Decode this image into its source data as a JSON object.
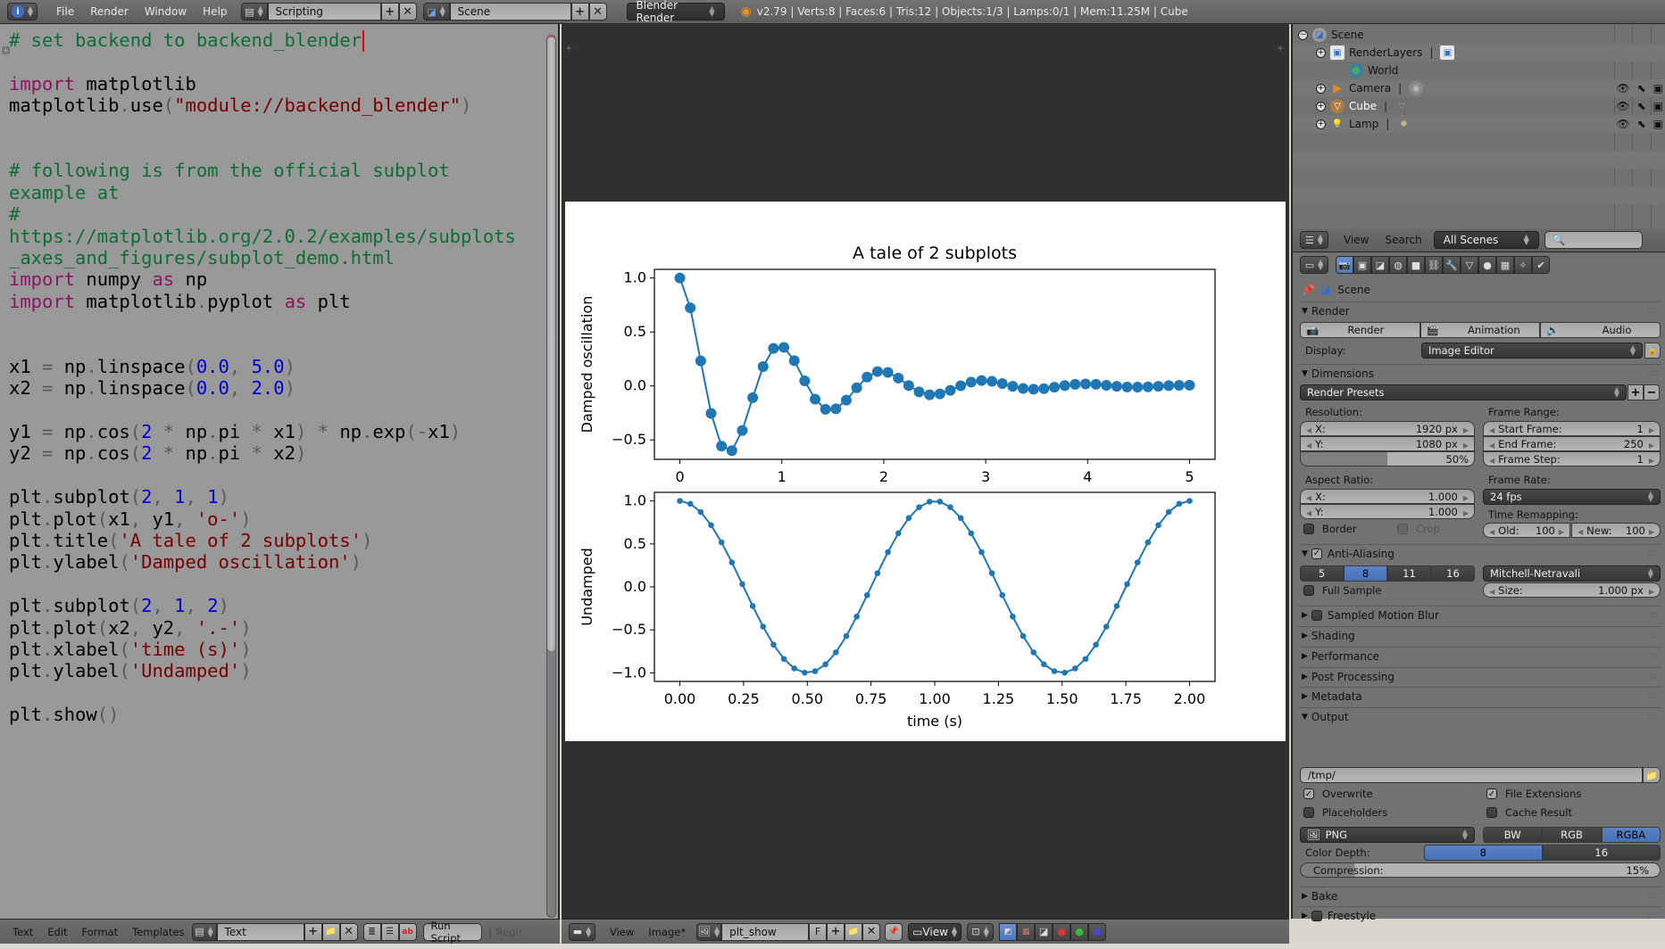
{
  "topbar": {
    "info_icon": "info-icon",
    "menus": [
      "File",
      "Render",
      "Window",
      "Help"
    ],
    "screen_layout": "Scripting",
    "scene": "Scene",
    "render_engine": "Blender Render",
    "stats": "v2.79 | Verts:8 | Faces:6 | Tris:12 | Objects:1/3 | Lamps:0/1 | Mem:11.25M | Cube"
  },
  "text_editor": {
    "code_lines": [
      [
        [
          "c-com",
          "# set backend to backend_blender"
        ]
      ],
      [],
      [
        [
          "c-kw",
          "import"
        ],
        [
          "",
          " matplotlib"
        ]
      ],
      [
        [
          "",
          "matplotlib"
        ],
        [
          "c-op",
          "."
        ],
        [
          "",
          "use"
        ],
        [
          "c-op",
          "("
        ],
        [
          "c-str",
          "\"module://backend_blender\""
        ],
        [
          "c-op",
          ")"
        ]
      ],
      [],
      [],
      [
        [
          "c-com",
          "# following is from the official subplot"
        ]
      ],
      [
        [
          "c-com",
          "example at"
        ]
      ],
      [
        [
          "c-com",
          "#"
        ]
      ],
      [
        [
          "c-com",
          "https://matplotlib.org/2.0.2/examples/subplots"
        ]
      ],
      [
        [
          "c-com",
          "_axes_and_figures/subplot_demo.html"
        ]
      ],
      [
        [
          "c-kw",
          "import"
        ],
        [
          "",
          " numpy "
        ],
        [
          "c-kw",
          "as"
        ],
        [
          "",
          " np"
        ]
      ],
      [
        [
          "c-kw",
          "import"
        ],
        [
          "",
          " matplotlib"
        ],
        [
          "c-op",
          "."
        ],
        [
          "",
          "pyplot "
        ],
        [
          "c-kw",
          "as"
        ],
        [
          "",
          " plt"
        ]
      ],
      [],
      [],
      [
        [
          "",
          "x1 "
        ],
        [
          "c-op",
          "="
        ],
        [
          "",
          " np"
        ],
        [
          "c-op",
          "."
        ],
        [
          "",
          "linspace"
        ],
        [
          "c-op",
          "("
        ],
        [
          "c-num",
          "0.0"
        ],
        [
          "c-op",
          ", "
        ],
        [
          "c-num",
          "5.0"
        ],
        [
          "c-op",
          ")"
        ]
      ],
      [
        [
          "",
          "x2 "
        ],
        [
          "c-op",
          "="
        ],
        [
          "",
          " np"
        ],
        [
          "c-op",
          "."
        ],
        [
          "",
          "linspace"
        ],
        [
          "c-op",
          "("
        ],
        [
          "c-num",
          "0.0"
        ],
        [
          "c-op",
          ", "
        ],
        [
          "c-num",
          "2.0"
        ],
        [
          "c-op",
          ")"
        ]
      ],
      [],
      [
        [
          "",
          "y1 "
        ],
        [
          "c-op",
          "="
        ],
        [
          "",
          " np"
        ],
        [
          "c-op",
          "."
        ],
        [
          "",
          "cos"
        ],
        [
          "c-op",
          "("
        ],
        [
          "c-num",
          "2"
        ],
        [
          "c-op",
          " * "
        ],
        [
          "",
          "np"
        ],
        [
          "c-op",
          "."
        ],
        [
          "",
          "pi "
        ],
        [
          "c-op",
          "*"
        ],
        [
          "",
          " x1"
        ],
        [
          "c-op",
          ") * "
        ],
        [
          "",
          "np"
        ],
        [
          "c-op",
          "."
        ],
        [
          "",
          "exp"
        ],
        [
          "c-op",
          "(-"
        ],
        [
          "",
          "x1"
        ],
        [
          "c-op",
          ")"
        ]
      ],
      [
        [
          "",
          "y2 "
        ],
        [
          "c-op",
          "="
        ],
        [
          "",
          " np"
        ],
        [
          "c-op",
          "."
        ],
        [
          "",
          "cos"
        ],
        [
          "c-op",
          "("
        ],
        [
          "c-num",
          "2"
        ],
        [
          "c-op",
          " * "
        ],
        [
          "",
          "np"
        ],
        [
          "c-op",
          "."
        ],
        [
          "",
          "pi "
        ],
        [
          "c-op",
          "*"
        ],
        [
          "",
          " x2"
        ],
        [
          "c-op",
          ")"
        ]
      ],
      [],
      [
        [
          "",
          "plt"
        ],
        [
          "c-op",
          "."
        ],
        [
          "",
          "subplot"
        ],
        [
          "c-op",
          "("
        ],
        [
          "c-num",
          "2"
        ],
        [
          "c-op",
          ", "
        ],
        [
          "c-num",
          "1"
        ],
        [
          "c-op",
          ", "
        ],
        [
          "c-num",
          "1"
        ],
        [
          "c-op",
          ")"
        ]
      ],
      [
        [
          "",
          "plt"
        ],
        [
          "c-op",
          "."
        ],
        [
          "",
          "plot"
        ],
        [
          "c-op",
          "("
        ],
        [
          "",
          "x1"
        ],
        [
          "c-op",
          ", "
        ],
        [
          "",
          "y1"
        ],
        [
          "c-op",
          ", "
        ],
        [
          "c-str",
          "'o-'"
        ],
        [
          "c-op",
          ")"
        ]
      ],
      [
        [
          "",
          "plt"
        ],
        [
          "c-op",
          "."
        ],
        [
          "",
          "title"
        ],
        [
          "c-op",
          "("
        ],
        [
          "c-str",
          "'A tale of 2 subplots'"
        ],
        [
          "c-op",
          ")"
        ]
      ],
      [
        [
          "",
          "plt"
        ],
        [
          "c-op",
          "."
        ],
        [
          "",
          "ylabel"
        ],
        [
          "c-op",
          "("
        ],
        [
          "c-str",
          "'Damped oscillation'"
        ],
        [
          "c-op",
          ")"
        ]
      ],
      [],
      [
        [
          "",
          "plt"
        ],
        [
          "c-op",
          "."
        ],
        [
          "",
          "subplot"
        ],
        [
          "c-op",
          "("
        ],
        [
          "c-num",
          "2"
        ],
        [
          "c-op",
          ", "
        ],
        [
          "c-num",
          "1"
        ],
        [
          "c-op",
          ", "
        ],
        [
          "c-num",
          "2"
        ],
        [
          "c-op",
          ")"
        ]
      ],
      [
        [
          "",
          "plt"
        ],
        [
          "c-op",
          "."
        ],
        [
          "",
          "plot"
        ],
        [
          "c-op",
          "("
        ],
        [
          "",
          "x2"
        ],
        [
          "c-op",
          ", "
        ],
        [
          "",
          "y2"
        ],
        [
          "c-op",
          ", "
        ],
        [
          "c-str",
          "'.-'"
        ],
        [
          "c-op",
          ")"
        ]
      ],
      [
        [
          "",
          "plt"
        ],
        [
          "c-op",
          "."
        ],
        [
          "",
          "xlabel"
        ],
        [
          "c-op",
          "("
        ],
        [
          "c-str",
          "'time (s)'"
        ],
        [
          "c-op",
          ")"
        ]
      ],
      [
        [
          "",
          "plt"
        ],
        [
          "c-op",
          "."
        ],
        [
          "",
          "ylabel"
        ],
        [
          "c-op",
          "("
        ],
        [
          "c-str",
          "'Undamped'"
        ],
        [
          "c-op",
          ")"
        ]
      ],
      [],
      [
        [
          "",
          "plt"
        ],
        [
          "c-op",
          "."
        ],
        [
          "",
          "show"
        ],
        [
          "c-op",
          "()"
        ]
      ]
    ],
    "footer": {
      "menus": [
        "Text",
        "Edit",
        "Format",
        "Templates"
      ],
      "datablock": "Text",
      "run_script": "Run Script",
      "register_label": "Register"
    }
  },
  "image_editor": {
    "footer": {
      "menus": [
        "View",
        "Image*"
      ],
      "image_name": "plt_show",
      "fake_user": "F",
      "view_mode": "View"
    }
  },
  "chart_data": [
    {
      "type": "line",
      "title": "A tale of 2 subplots",
      "xlabel": "",
      "ylabel": "Damped oscillation",
      "formula": "cos(2*pi*x)*exp(-x)",
      "x_range": [
        0.0,
        5.0
      ],
      "n_points": 50,
      "marker": "o",
      "color": "#1f77b4",
      "xlim": [
        -0.25,
        5.25
      ],
      "ylim": [
        -0.68,
        1.08
      ],
      "xticks": [
        "0",
        "1",
        "2",
        "3",
        "4",
        "5"
      ],
      "yticks": [
        "−0.5",
        "0.0",
        "0.5",
        "1.0"
      ],
      "ytick_values": [
        -0.5,
        0.0,
        0.5,
        1.0
      ]
    },
    {
      "type": "line",
      "title": "",
      "xlabel": "time (s)",
      "ylabel": "Undamped",
      "formula": "cos(2*pi*x)",
      "x_range": [
        0.0,
        2.0
      ],
      "n_points": 50,
      "marker": ".",
      "color": "#1f77b4",
      "xlim": [
        -0.1,
        2.1
      ],
      "ylim": [
        -1.1,
        1.1
      ],
      "xticks": [
        "0.00",
        "0.25",
        "0.50",
        "0.75",
        "1.00",
        "1.25",
        "1.50",
        "1.75",
        "2.00"
      ],
      "xtick_values": [
        0,
        0.25,
        0.5,
        0.75,
        1.0,
        1.25,
        1.5,
        1.75,
        2.0
      ],
      "yticks": [
        "−1.0",
        "−0.5",
        "0.0",
        "0.5",
        "1.0"
      ],
      "ytick_values": [
        -1.0,
        -0.5,
        0.0,
        0.5,
        1.0
      ]
    }
  ],
  "outliner": {
    "items": [
      {
        "label": "Scene",
        "icon": "scene-icon",
        "level": 0,
        "expanded": true
      },
      {
        "label": "RenderLayers",
        "icon": "render-layers-icon",
        "level": 1,
        "sub_icon": "render-layer-icon"
      },
      {
        "label": "World",
        "icon": "world-icon",
        "level": 1
      },
      {
        "label": "Camera",
        "icon": "camera-object-icon",
        "level": 1,
        "sub_icon": "camera-data-icon",
        "visibility": true
      },
      {
        "label": "Cube",
        "icon": "mesh-object-icon",
        "level": 1,
        "sub_icon": "mesh-data-icon",
        "visibility": true,
        "active": true
      },
      {
        "label": "Lamp",
        "icon": "lamp-object-icon",
        "level": 1,
        "sub_icon": "lamp-data-icon",
        "visibility": true
      }
    ],
    "header": {
      "menus": [
        "View",
        "Search"
      ],
      "filter": "All Scenes",
      "search_placeholder": ""
    }
  },
  "properties": {
    "context": "Scene",
    "tabs": [
      "render",
      "render-layers",
      "scene",
      "world",
      "object",
      "constraints",
      "modifiers",
      "data",
      "material",
      "texture",
      "particles",
      "physics"
    ],
    "active_tab": "render",
    "render_panel": {
      "title": "Render",
      "buttons": [
        "Render",
        "Animation",
        "Audio"
      ],
      "display_label": "Display:",
      "display_value": "Image Editor"
    },
    "dimensions": {
      "title": "Dimensions",
      "presets": "Render Presets",
      "resolution_label": "Resolution:",
      "res_x_label": "X:",
      "res_x": "1920 px",
      "res_y_label": "Y:",
      "res_y": "1080 px",
      "res_percent": "50%",
      "res_percent_value": 50,
      "aspect_label": "Aspect Ratio:",
      "aspect_x": "1.000",
      "aspect_y": "1.000",
      "border": "Border",
      "crop": "Crop",
      "frame_range_label": "Frame Range:",
      "start_label": "Start Frame:",
      "start": "1",
      "end_label": "End Frame:",
      "end": "250",
      "step_label": "Frame Step:",
      "step": "1",
      "frame_rate_label": "Frame Rate:",
      "frame_rate": "24 fps",
      "time_remap_label": "Time Remapping:",
      "old_label": "Old:",
      "old": "100",
      "new_label": "New:",
      "new": "100"
    },
    "anti_aliasing": {
      "title": "Anti-Aliasing",
      "enabled": true,
      "samples": [
        "5",
        "8",
        "11",
        "16"
      ],
      "selected": "8",
      "full_sample": "Full Sample",
      "filter": "Mitchell-Netravali",
      "size_label": "Size:",
      "size": "1.000 px"
    },
    "collapsed_panels": [
      "Sampled Motion Blur",
      "Shading",
      "Performance",
      "Post Processing",
      "Metadata"
    ],
    "output": {
      "title": "Output",
      "path": "/tmp/",
      "overwrite": "Overwrite",
      "file_extensions": "File Extensions",
      "placeholders": "Placeholders",
      "cache_result": "Cache Result",
      "format": "PNG",
      "color_modes": [
        "BW",
        "RGB",
        "RGBA"
      ],
      "color_mode_selected": "RGBA",
      "color_depth_label": "Color Depth:",
      "color_depths": [
        "8",
        "16"
      ],
      "color_depth_selected": "8",
      "compression_label": "Compression:",
      "compression": "15%",
      "compression_value": 15
    },
    "bottom_panels": [
      "Bake",
      "Freestyle"
    ]
  }
}
